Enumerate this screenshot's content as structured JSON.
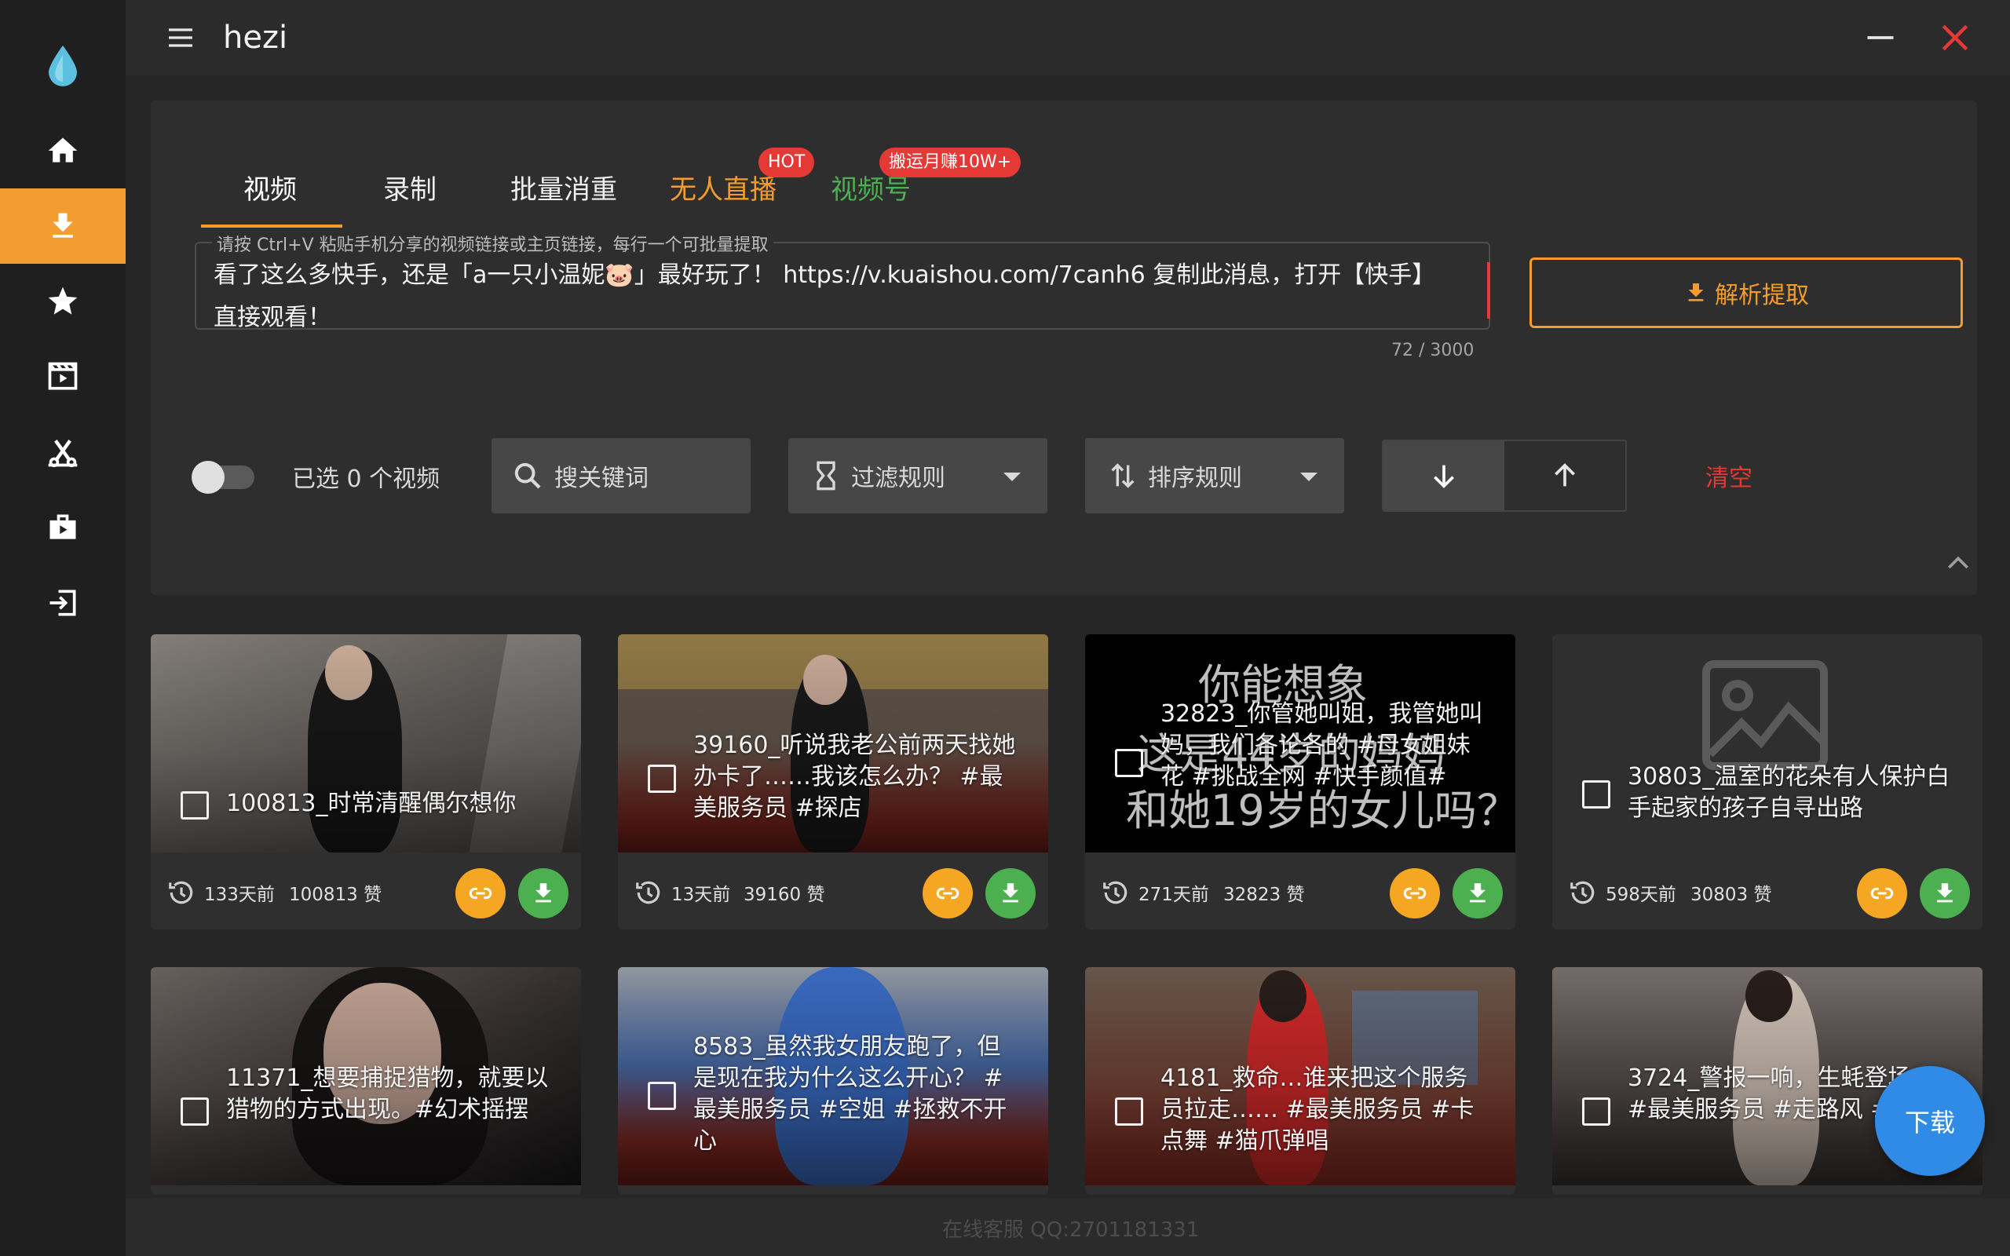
{
  "app": {
    "title": "hezi"
  },
  "sidebar": {
    "items": [
      {
        "icon": "home-icon"
      },
      {
        "icon": "download-icon",
        "active": true
      },
      {
        "icon": "star-icon"
      },
      {
        "icon": "clapperboard-icon"
      },
      {
        "icon": "scissors-icon"
      },
      {
        "icon": "video-briefcase-icon"
      },
      {
        "icon": "logout-icon"
      }
    ]
  },
  "tabs": [
    {
      "label": "视频",
      "active": true
    },
    {
      "label": "录制"
    },
    {
      "label": "批量消重"
    },
    {
      "label": "无人直播",
      "badge": "HOT",
      "color": "#f39c2f"
    },
    {
      "label": "视频号",
      "badge": "搬运月赚10W+",
      "color": "#4caf50"
    }
  ],
  "input": {
    "legend": "请按 Ctrl+V 粘贴手机分享的视频链接或主页链接，每行一个可批量提取",
    "value": "看了这么多快手，还是「a一只小温妮🐷」最好玩了！ https://v.kuaishou.com/7canh6 复制此消息，打开【快手】直接观看！",
    "counter": "72 / 3000"
  },
  "actions": {
    "parse_label": "解析提取",
    "accent": "#f39c2f"
  },
  "filters": {
    "selected_text": "已选 0 个视频",
    "search_placeholder": "搜关键词",
    "filter_label": "过滤规则",
    "sort_label": "排序规则",
    "clear_label": "清空"
  },
  "cards": [
    {
      "title": "100813_时常清醒偶尔想你",
      "time": "133天前",
      "likes": "100813 赞"
    },
    {
      "title": "39160_听说我老公前两天找她办卡了……我该怎么办？ #最美服务员 #探店",
      "time": "13天前",
      "likes": "39160 赞"
    },
    {
      "title": "32823_你管她叫姐，我管她叫妈，我们各论各的 #母女姐妹花 #挑战全网 #快手颜值#",
      "time": "271天前",
      "likes": "32823 赞",
      "overlay_lines": [
        "你能想象",
        "这是44岁的妈妈",
        "和她19岁的女儿吗？"
      ]
    },
    {
      "title": "30803_温室的花朵有人保护白手起家的孩子自寻出路",
      "time": "598天前",
      "likes": "30803 赞"
    },
    {
      "title": "11371_想要捕捉猎物，就要以猎物的方式出现。#幻术摇摆"
    },
    {
      "title": "8583_虽然我女朋友跑了，但是现在我为什么这么开心？ #最美服务员 #空姐 #拯救不开心"
    },
    {
      "title": "4181_救命…谁来把这个服务员拉走…… #最美服务员 #卡点舞 #猫爪弹唱"
    },
    {
      "title": "3724_警报一响，生蚝登场！ #最美服务员 #走路风 #变身"
    }
  ],
  "fab": {
    "label": "下载",
    "color": "#2f8be6"
  },
  "footer": {
    "service": "在线客服 QQ:2701181331"
  }
}
